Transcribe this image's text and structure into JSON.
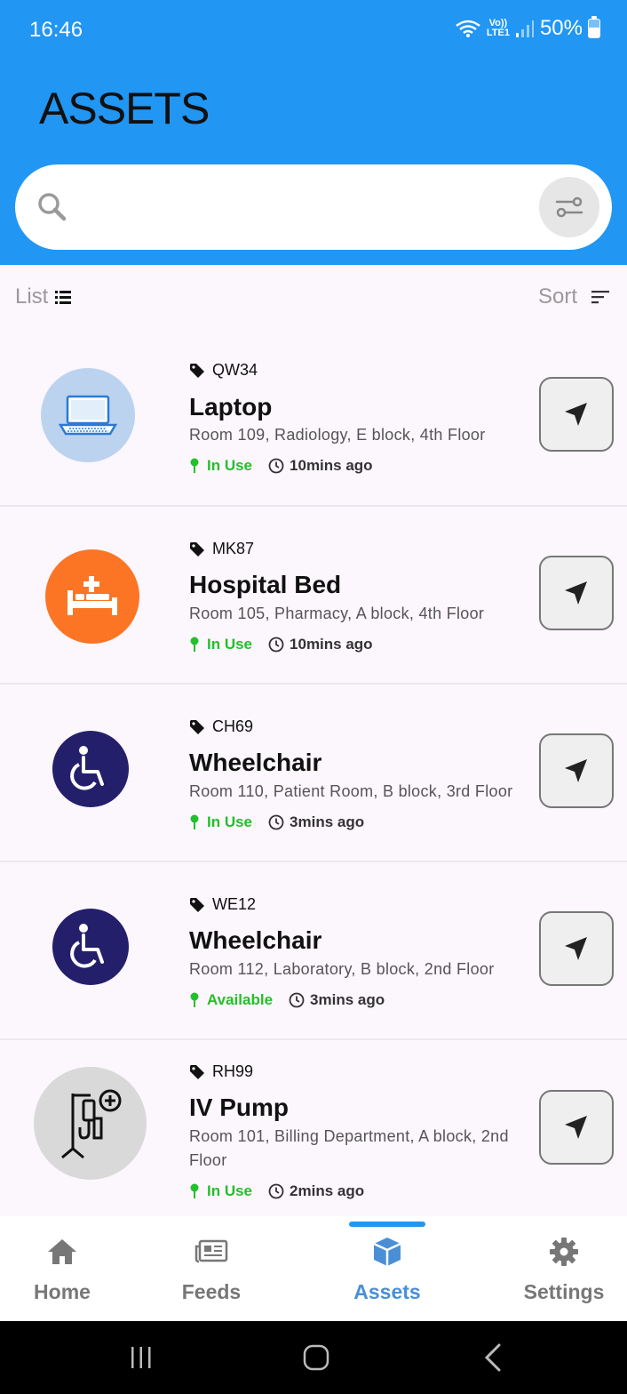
{
  "status_bar": {
    "time": "16:46",
    "net_top": "Vo))",
    "net_bottom": "LTE1",
    "battery": "50%"
  },
  "header": {
    "title": "ASSETS"
  },
  "search": {
    "placeholder": ""
  },
  "toolbar": {
    "list_label": "List",
    "sort_label": "Sort"
  },
  "assets": [
    {
      "tag": "QW34",
      "name": "Laptop",
      "location": "Room 109, Radiology, E block, 4th Floor",
      "status": "In Use",
      "ago": "10mins ago",
      "icon": "laptop-icon",
      "icon_bg": "#bcd3f0"
    },
    {
      "tag": "MK87",
      "name": "Hospital Bed",
      "location": "Room 105, Pharmacy, A block, 4th Floor",
      "status": "In Use",
      "ago": "10mins ago",
      "icon": "hospital-bed-icon",
      "icon_bg": "#fb7524"
    },
    {
      "tag": "CH69",
      "name": "Wheelchair",
      "location": "Room 110, Patient Room, B block, 3rd Floor",
      "status": "In Use",
      "ago": "3mins ago",
      "icon": "wheelchair-icon",
      "icon_bg": "#241f6b"
    },
    {
      "tag": "WE12",
      "name": "Wheelchair",
      "location": "Room 112, Laboratory, B block, 2nd Floor",
      "status": "Available",
      "ago": "3mins ago",
      "icon": "wheelchair-icon",
      "icon_bg": "#241f6b"
    },
    {
      "tag": "RH99",
      "name": "IV Pump",
      "location": "Room 101, Billing Department, A block, 2nd Floor",
      "status": "In Use",
      "ago": "2mins ago",
      "icon": "iv-pump-icon",
      "icon_bg": "#d9d9d9"
    }
  ],
  "bottom_nav": [
    {
      "label": "Home",
      "icon": "home-icon"
    },
    {
      "label": "Feeds",
      "icon": "newspaper-icon"
    },
    {
      "label": "Assets",
      "icon": "cube-icon",
      "active": true
    },
    {
      "label": "Settings",
      "icon": "gear-icon"
    }
  ],
  "colors": {
    "header": "#2196f3",
    "status_green": "#22c02a",
    "active_nav": "#4a8fd6"
  }
}
